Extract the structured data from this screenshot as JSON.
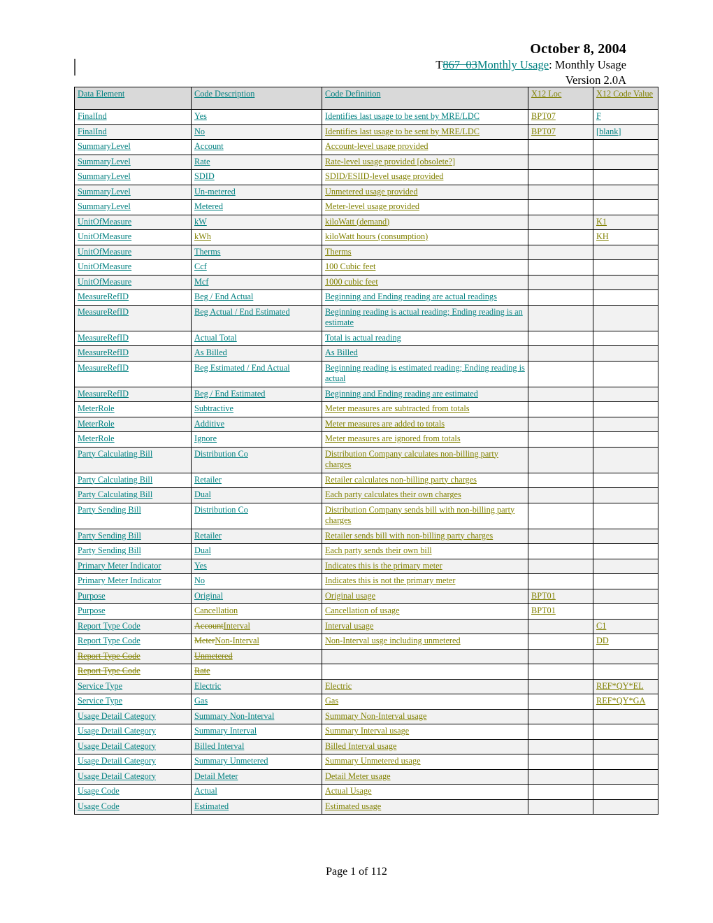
{
  "header": {
    "date": "October 8, 2004",
    "subtitle_prefix": "T",
    "subtitle_struck": "867_03",
    "subtitle_inserted": "Monthly Usage",
    "subtitle_suffix": ": Monthly Usage",
    "version": "Version 2.0A"
  },
  "colors": {
    "teal": "#008080",
    "olive": "#808000",
    "header_fill": "#d9d9d9",
    "row_shade": "#f2f2f2",
    "border": "#000000",
    "change_bar": "#595959"
  },
  "table": {
    "columns": [
      "Data Element",
      "Code Description",
      "Code Definition",
      "X12 Loc",
      "X12 Code Value"
    ],
    "rows": [
      {
        "c1": "FinalInd",
        "c2": "Yes",
        "c3": "Identifies last usage to be sent by MRE/LDC",
        "c4": "BPT07",
        "c5": "F"
      },
      {
        "c1": "FinalInd",
        "c2": "No",
        "c3": "Identifies last usage to be sent by MRE/LDC",
        "c4": "BPT07",
        "c5": "[blank]"
      },
      {
        "c1": "SummaryLevel",
        "c2": "Account",
        "c3": "Account-level usage provided",
        "c4": "",
        "c5": ""
      },
      {
        "c1": "SummaryLevel",
        "c2": "Rate",
        "c3": "Rate-level usage provided [obsolete?]",
        "c4": "",
        "c5": ""
      },
      {
        "c1": "SummaryLevel",
        "c2": "SDID",
        "c3": "SDID/ESIID-level usage provided",
        "c4": "",
        "c5": ""
      },
      {
        "c1": "SummaryLevel",
        "c2": "Un-metered",
        "c3": "Unmetered usage provided",
        "c4": "",
        "c5": ""
      },
      {
        "c1": "SummaryLevel",
        "c2": "Metered",
        "c3": "Meter-level usage provided",
        "c4": "",
        "c5": ""
      },
      {
        "c1": "UnitOfMeasure",
        "c2": "kW",
        "c3": "kiloWatt (demand)",
        "c4": "",
        "c5": "K1"
      },
      {
        "c1": "UnitOfMeasure",
        "c2": "kWh",
        "c3": "kiloWatt hours (consumption)",
        "c4": "",
        "c5": "KH"
      },
      {
        "c1": "UnitOfMeasure",
        "c2": "Therms",
        "c3": "Therms",
        "c4": "",
        "c5": ""
      },
      {
        "c1": "UnitOfMeasure",
        "c2": "Ccf",
        "c3": "100 Cubic feet",
        "c4": "",
        "c5": ""
      },
      {
        "c1": "UnitOfMeasure",
        "c2": "Mcf",
        "c3": "1000 cubic feet",
        "c4": "",
        "c5": ""
      },
      {
        "c1": "MeasureRefID",
        "c2": "Beg / End Actual",
        "c3": "Beginning and Ending reading are actual readings",
        "c4": "",
        "c5": ""
      },
      {
        "c1": "MeasureRefID",
        "c2": "Beg Actual / End Estimated",
        "c3": "Beginning reading is actual reading; Ending reading is an estimate",
        "c4": "",
        "c5": ""
      },
      {
        "c1": "MeasureRefID",
        "c2": "Actual Total",
        "c3": "Total is actual reading",
        "c4": "",
        "c5": ""
      },
      {
        "c1": "MeasureRefID",
        "c2": "As Billed",
        "c3": "As Billed",
        "c4": "",
        "c5": ""
      },
      {
        "c1": "MeasureRefID",
        "c2": "Beg Estimated / End Actual",
        "c3": "Beginning reading is estimated reading; Ending reading is actual",
        "c4": "",
        "c5": ""
      },
      {
        "c1": "MeasureRefID",
        "c2": "Beg / End Estimated",
        "c3": "Beginning and Ending reading are estimated",
        "c4": "",
        "c5": ""
      },
      {
        "c1": "MeterRole",
        "c2": "Subtractive",
        "c3": "Meter measures are subtracted from totals",
        "c4": "",
        "c5": ""
      },
      {
        "c1": "MeterRole",
        "c2": "Additive",
        "c3": "Meter measures are added to totals",
        "c4": "",
        "c5": ""
      },
      {
        "c1": "MeterRole",
        "c2": "Ignore",
        "c3": "Meter measures are ignored from totals",
        "c4": "",
        "c5": ""
      },
      {
        "c1": "Party Calculating Bill",
        "c2": "Distribution Co",
        "c3": "Distribution Company calculates non-billing party charges",
        "c4": "",
        "c5": ""
      },
      {
        "c1": "Party Calculating Bill",
        "c2": "Retailer",
        "c3": "Retailer calculates non-billing party charges",
        "c4": "",
        "c5": ""
      },
      {
        "c1": "Party Calculating Bill",
        "c2": "Dual",
        "c3": "Each party calculates their own charges",
        "c4": "",
        "c5": ""
      },
      {
        "c1": "Party Sending Bill",
        "c2": "Distribution Co",
        "c3": "Distribution Company sends bill with non-billing party charges",
        "c4": "",
        "c5": ""
      },
      {
        "c1": "Party Sending Bill",
        "c2": "Retailer",
        "c3": "Retailer sends bill with non-billing party charges",
        "c4": "",
        "c5": ""
      },
      {
        "c1": "Party Sending Bill",
        "c2": "Dual",
        "c3": "Each party sends their own bill",
        "c4": "",
        "c5": ""
      },
      {
        "c1": "Primary Meter Indicator",
        "c2": "Yes",
        "c3": "Indicates this is the primary meter",
        "c4": "",
        "c5": ""
      },
      {
        "c1": "Primary Meter Indicator",
        "c2": "No",
        "c3": "Indicates this is not the primary meter",
        "c4": "",
        "c5": ""
      },
      {
        "c1": "Purpose",
        "c2": "Original",
        "c3": "Original usage",
        "c4": "BPT01",
        "c5": ""
      },
      {
        "c1": "Purpose",
        "c2": "Cancellation",
        "c3": "Cancellation of usage",
        "c4": "BPT01",
        "c5": ""
      },
      {
        "c1": "Report Type Code",
        "c2_struck": "Account",
        "c2": "Interval",
        "c3": "Interval usage",
        "c4": "",
        "c5": "C1"
      },
      {
        "c1": "Report Type Code",
        "c2_struck": "Meter",
        "c2": "Non-Interval",
        "c3": "Non-Interval usge including unmetered",
        "c4": "",
        "c5": "DD"
      },
      {
        "c1_struck": "Report Type Code",
        "c2_struck": " Unmetered",
        "c3": "",
        "c4": "",
        "c5": "",
        "variant": "odd-width deleted row"
      },
      {
        "c1_struck": "Report Type Code",
        "c2_struck": " Rate",
        "c3": "",
        "c4": "",
        "c5": "",
        "variant": "odd-width deleted row"
      },
      {
        "c1": "Service Type",
        "c2": "Electric",
        "c3": "Electric",
        "c4": "",
        "c5": "REF*QY*EL"
      },
      {
        "c1": "Service Type",
        "c2": "Gas",
        "c3": "Gas",
        "c4": "",
        "c5": "REF*QY*GA"
      },
      {
        "c1": "Usage Detail Category",
        "c2": "Summary Non-Interval",
        "c3": "Summary Non-Interval usage",
        "c4": "",
        "c5": ""
      },
      {
        "c1": "Usage Detail Category",
        "c2": "Summary Interval",
        "c3": "Summary Interval usage",
        "c4": "",
        "c5": ""
      },
      {
        "c1": "Usage Detail Category",
        "c2": "Billed Interval",
        "c3": "Billed Interval usage",
        "c4": "",
        "c5": ""
      },
      {
        "c1": "Usage Detail Category",
        "c2": "Summary Unmetered",
        "c3": "Summary Unmetered usage",
        "c4": "",
        "c5": ""
      },
      {
        "c1": "Usage Detail Category",
        "c2": "Detail Meter",
        "c3": "Detail Meter usage",
        "c4": "",
        "c5": ""
      },
      {
        "c1": "Usage Code",
        "c2": "Actual",
        "c3": "Actual Usage",
        "c4": "",
        "c5": ""
      },
      {
        "c1": "Usage Code",
        "c2": "Estimated",
        "c3": "Estimated usage",
        "c4": "",
        "c5": ""
      }
    ]
  },
  "footer": {
    "page_label": "Page 1 of 112"
  }
}
